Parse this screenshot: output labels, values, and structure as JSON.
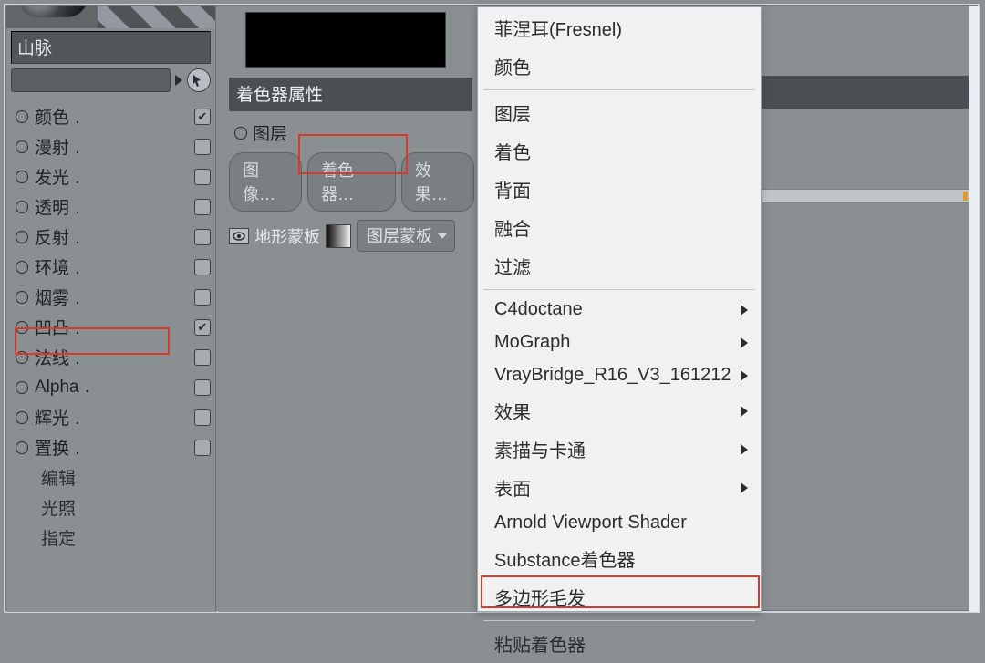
{
  "material": {
    "name": "山脉"
  },
  "channels": {
    "items": [
      {
        "label": "颜色",
        "checked": true
      },
      {
        "label": "漫射",
        "checked": false
      },
      {
        "label": "发光",
        "checked": false
      },
      {
        "label": "透明",
        "checked": false
      },
      {
        "label": "反射",
        "checked": false
      },
      {
        "label": "环境",
        "checked": false
      },
      {
        "label": "烟雾",
        "checked": false
      },
      {
        "label": "凹凸",
        "checked": true
      },
      {
        "label": "法线",
        "checked": false
      },
      {
        "label": "Alpha",
        "checked": false
      },
      {
        "label": "辉光",
        "checked": false
      },
      {
        "label": "置换",
        "checked": false
      }
    ],
    "extras": [
      {
        "label": "编辑"
      },
      {
        "label": "光照"
      },
      {
        "label": "指定"
      }
    ]
  },
  "shader_props": {
    "header": "着色器属性",
    "layer_label": "图层",
    "buttons": {
      "image": "图像…",
      "shader": "着色器…",
      "effect": "效果…"
    },
    "layer_row": {
      "name": "地形蒙板",
      "dropdown": "图层蒙板"
    }
  },
  "menu": {
    "top": [
      {
        "label": "菲涅耳(Fresnel)"
      },
      {
        "label": "颜色"
      }
    ],
    "mid1": [
      {
        "label": "图层"
      },
      {
        "label": "着色"
      },
      {
        "label": "背面"
      },
      {
        "label": "融合"
      },
      {
        "label": "过滤"
      }
    ],
    "mid2": [
      {
        "label": "C4doctane",
        "sub": true
      },
      {
        "label": "MoGraph",
        "sub": true
      },
      {
        "label": "VrayBridge_R16_V3_161212",
        "sub": true
      },
      {
        "label": "效果",
        "sub": true
      },
      {
        "label": "素描与卡通",
        "sub": true
      },
      {
        "label": "表面",
        "sub": true
      },
      {
        "label": "Arnold Viewport Shader"
      },
      {
        "label": "Substance着色器"
      },
      {
        "label": "多边形毛发"
      }
    ],
    "bottom": [
      {
        "label": "粘贴着色器"
      }
    ]
  }
}
